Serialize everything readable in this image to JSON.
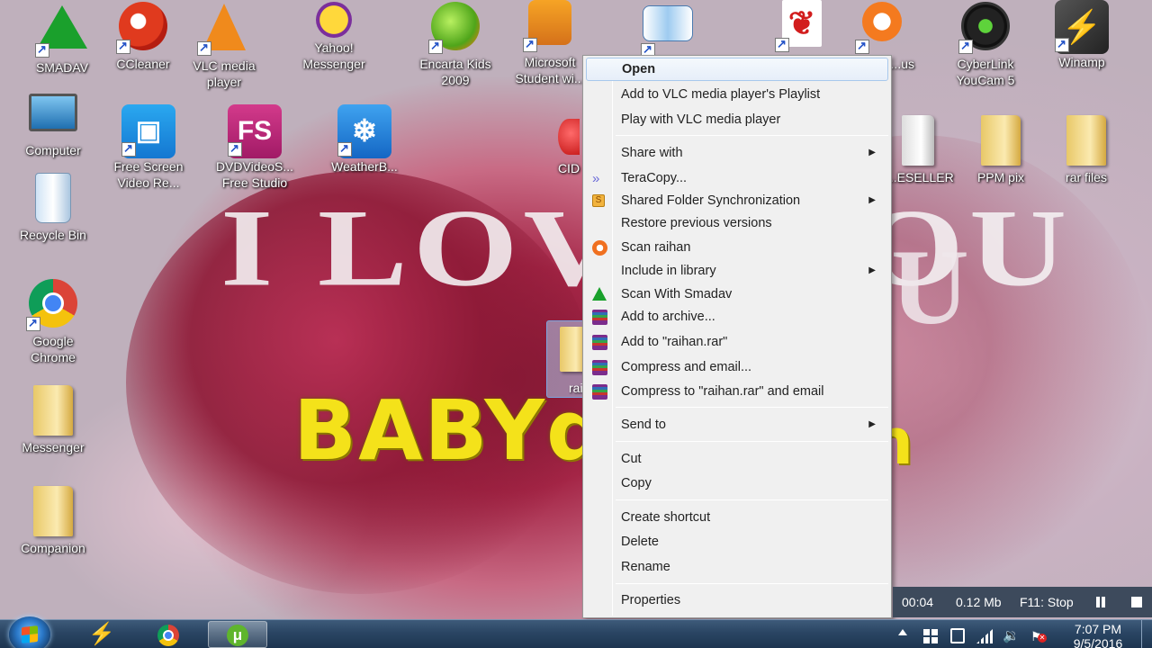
{
  "wallpaper": {
    "line1": "I LOVE YOU",
    "line1_right": "U",
    "line2": "BABYq",
    "line2_right": "n"
  },
  "desktop_icons": [
    {
      "label": "SMADAV",
      "icon": "smadav-icon"
    },
    {
      "label": "CCleaner",
      "icon": "ccleaner-icon"
    },
    {
      "label": "VLC media player",
      "icon": "vlc-icon"
    },
    {
      "label": "Yahoo! Messenger",
      "icon": "yahoo-messenger-icon"
    },
    {
      "label": "Encarta Kids 2009",
      "icon": "encarta-icon"
    },
    {
      "label": "Microsoft Student wi...",
      "icon": "microsoft-student-icon"
    },
    {
      "label": "",
      "icon": "book-icon"
    },
    {
      "label": "",
      "icon": "adobe-reader-icon"
    },
    {
      "label": "...ree ...us",
      "icon": "avast-icon"
    },
    {
      "label": "CyberLink YouCam 5",
      "icon": "youcam-icon"
    },
    {
      "label": "Winamp",
      "icon": "winamp-icon"
    },
    {
      "label": "Computer",
      "icon": "computer-icon"
    },
    {
      "label": "Free Screen Video Re...",
      "icon": "screen-recorder-icon"
    },
    {
      "label": "DVDVideoS... Free Studio",
      "icon": "dvdvideosoft-icon"
    },
    {
      "label": "WeatherB...",
      "icon": "weather-icon"
    },
    {
      "label": "CID",
      "icon": "cid-icon"
    },
    {
      "label": "...ESELLER",
      "icon": "folder-icon"
    },
    {
      "label": "PPM pix",
      "icon": "folder-icon"
    },
    {
      "label": "rar files",
      "icon": "folder-icon"
    },
    {
      "label": "Recycle Bin",
      "icon": "recycle-bin-icon"
    },
    {
      "label": "Google Chrome",
      "icon": "chrome-icon"
    },
    {
      "label": "Messenger",
      "icon": "folder-icon"
    },
    {
      "label": "Companion",
      "icon": "folder-icon"
    },
    {
      "label": "rai",
      "icon": "folder-icon"
    }
  ],
  "menu_items": [
    {
      "label": "Open",
      "bold": true,
      "highlighted": true
    },
    {
      "label": "Add to VLC media player's Playlist"
    },
    {
      "label": "Play with VLC media player"
    },
    {
      "label": "Share with",
      "submenu": true
    },
    {
      "label": "TeraCopy...",
      "icon": "teracopy-icon"
    },
    {
      "label": "Shared Folder Synchronization",
      "icon": "sync-icon",
      "submenu": true
    },
    {
      "label": "Restore previous versions"
    },
    {
      "label": "Scan raihan",
      "icon": "avast-scan-icon"
    },
    {
      "label": "Include in library",
      "submenu": true
    },
    {
      "label": "Scan With Smadav",
      "icon": "smadav-icon"
    },
    {
      "label": "Add to archive...",
      "icon": "winrar-icon"
    },
    {
      "label": "Add to \"raihan.rar\"",
      "icon": "winrar-icon"
    },
    {
      "label": "Compress and email...",
      "icon": "winrar-icon"
    },
    {
      "label": "Compress to \"raihan.rar\" and email",
      "icon": "winrar-icon"
    },
    {
      "label": "Send to",
      "submenu": true
    },
    {
      "label": "Cut"
    },
    {
      "label": "Copy"
    },
    {
      "label": "Create shortcut"
    },
    {
      "label": "Delete"
    },
    {
      "label": "Rename"
    },
    {
      "label": "Properties"
    }
  ],
  "recorder": {
    "elapsed": "00:04",
    "size": "0.12 Mb",
    "stop_hint": "F11: Stop"
  },
  "taskbar": {
    "apps": [
      "windows-start-icon",
      "winamp-icon",
      "chrome-icon",
      "utorrent-icon"
    ],
    "clock_time": "7:07 PM",
    "clock_date": "9/5/2016"
  },
  "colors": {
    "menu_bg": "#f0f0f0",
    "menu_highlight": "#e6eef9",
    "recorder_bg": "#3d4a5c",
    "taskbar": "#2a4563",
    "wallpaper_heart": "#a42546",
    "wallpaper_text_yellow": "#f4e21a"
  }
}
